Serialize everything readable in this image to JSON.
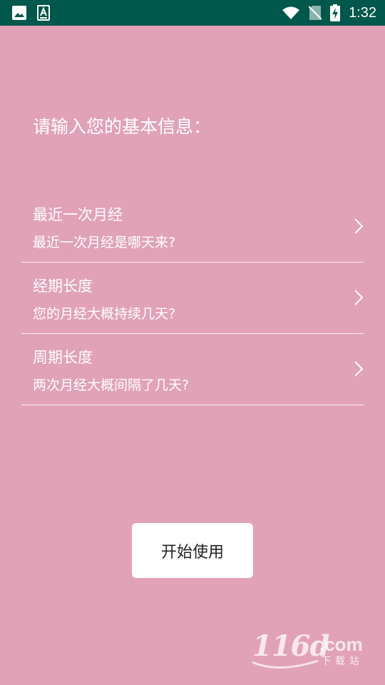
{
  "status_bar": {
    "time": "1:32",
    "icons": [
      "image-icon",
      "accessibility-a-icon",
      "wifi-icon",
      "no-sim-icon",
      "battery-charging-icon"
    ]
  },
  "page": {
    "title": "请输入您的基本信息："
  },
  "settings": {
    "items": [
      {
        "title": "最近一次月经",
        "subtitle": "最近一次月经是哪天来?"
      },
      {
        "title": "经期长度",
        "subtitle": "您的月经大概持续几天?"
      },
      {
        "title": "周期长度",
        "subtitle": "两次月经大概间隔了几天?"
      }
    ]
  },
  "start_button": {
    "label": "开始使用"
  },
  "watermark": {
    "logo": "116d",
    "domain": ".com",
    "tagline": "下载站"
  },
  "colors": {
    "background": "#E1A2B7",
    "status_bar": "#00574B",
    "button": "#FFFFFF",
    "text": "#FFFFFF"
  }
}
